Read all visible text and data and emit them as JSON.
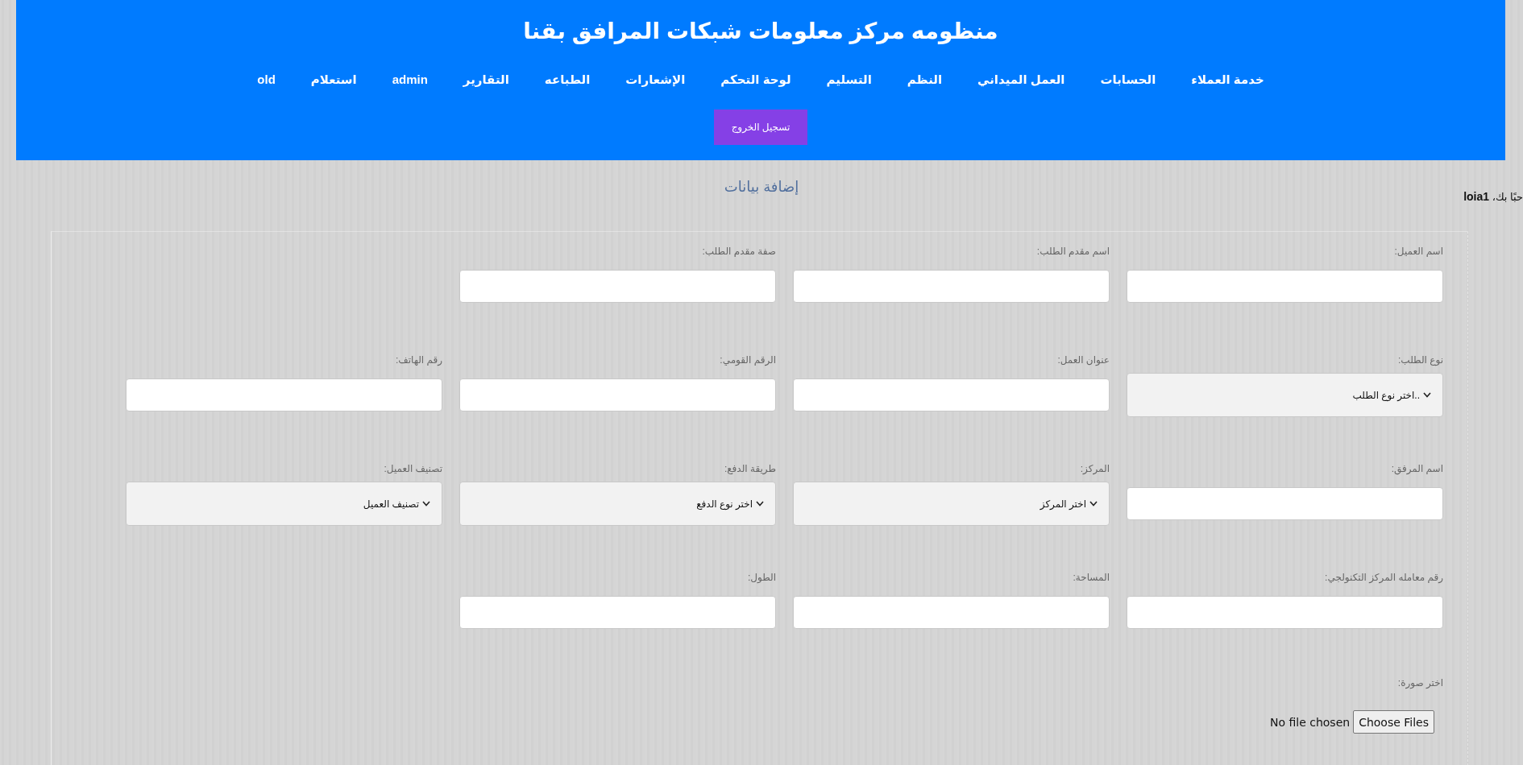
{
  "header": {
    "title": "منظومه مركز معلومات شبكات المرافق بقنا",
    "nav": [
      "خدمة العملاء",
      "الحسابات",
      "العمل الميداني",
      "النظم",
      "التسليم",
      "لوحة التحكم",
      "الإشعارات",
      "الطباعه",
      "التقارير",
      "admin",
      "استعلام",
      "old"
    ],
    "logout_button": "تسجيل الخروج"
  },
  "page_heading": "إضافة بيانات",
  "greeting": "حبًا بك، **loia1**",
  "form": {
    "rows": [
      [
        {
          "kind": "text",
          "label": "اسم العميل:"
        },
        {
          "kind": "text",
          "label": "اسم مقدم الطلب:"
        },
        {
          "kind": "text",
          "label": "صفة مقدم الطلب:"
        }
      ],
      [
        {
          "kind": "select",
          "label": "نوع الطلب:",
          "value": "اختر نوع الطلب.."
        },
        {
          "kind": "text",
          "label": "عنوان العمل:"
        },
        {
          "kind": "text",
          "label": "الرقم القومي:"
        },
        {
          "kind": "text",
          "label": "رقم الهاتف:"
        }
      ],
      [
        {
          "kind": "text",
          "label": "اسم المرفق:"
        },
        {
          "kind": "select",
          "label": "المركز:",
          "value": "اختر المركز"
        },
        {
          "kind": "select",
          "label": "طريقة الدفع:",
          "value": "اختر نوع الدفع"
        },
        {
          "kind": "select",
          "label": "تصنيف العميل:",
          "value": "تصنيف العميل"
        }
      ],
      [
        {
          "kind": "text",
          "label": "رقم معامله المركز التكنولجي:"
        },
        {
          "kind": "text",
          "label": "المساحة:"
        },
        {
          "kind": "text",
          "label": "الطول:"
        }
      ]
    ],
    "image_picker": {
      "label": "اختر صورة:",
      "button": "Choose Files",
      "status": "No file chosen"
    }
  }
}
